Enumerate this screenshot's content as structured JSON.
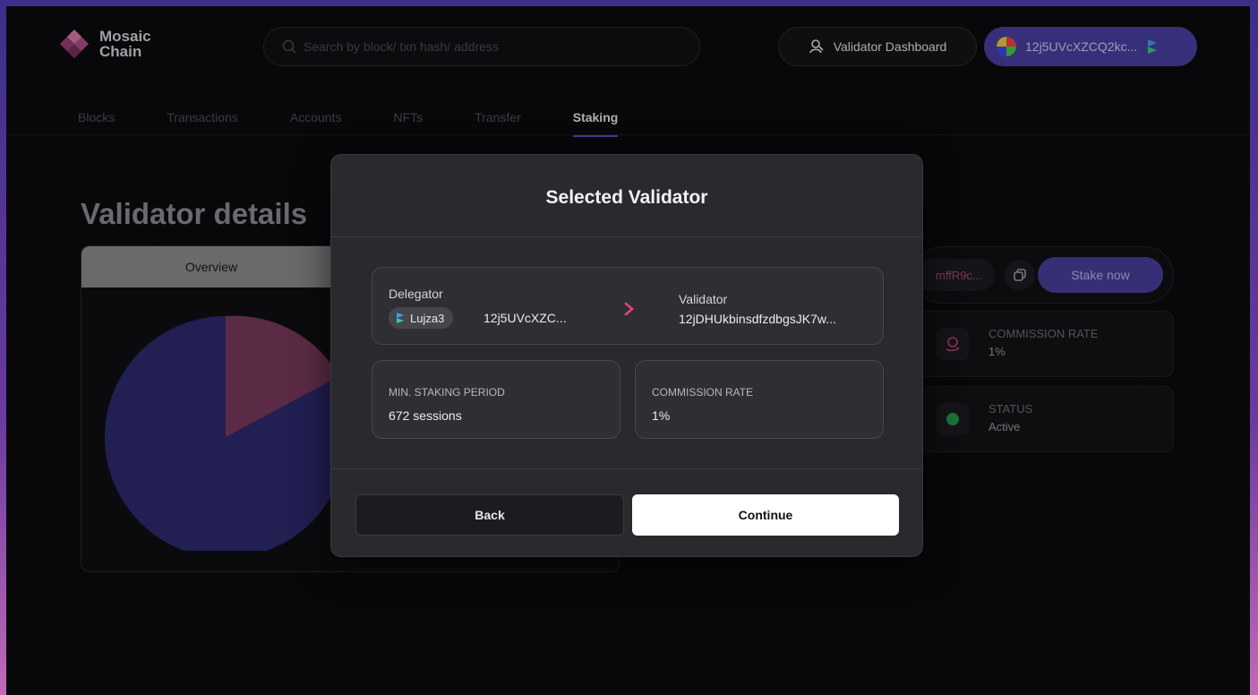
{
  "header": {
    "logo_line1": "Mosaic",
    "logo_line2": "Chain",
    "search_placeholder": "Search by block/ txn hash/ address",
    "dashboard_label": "Validator Dashboard",
    "wallet_address": "12j5UVcXZCQ2kc..."
  },
  "nav": {
    "items": [
      "Blocks",
      "Transactions",
      "Accounts",
      "NFTs",
      "Transfer",
      "Staking"
    ],
    "active": "Staking"
  },
  "page": {
    "title": "Validator details",
    "overview_tab": "Overview",
    "pie_chart_colors": [
      "#2e2a6e",
      "#7a3a5c"
    ],
    "validator_addr_short": "mffR9c...",
    "stake_now_label": "Stake now",
    "commission_label": "COMMISSION RATE",
    "commission_value": "1%",
    "status_label": "STATUS",
    "status_value": "Active",
    "status_color": "#239a4a"
  },
  "modal": {
    "title": "Selected Validator",
    "delegator_label": "Delegator",
    "delegator_name": "Lujza3",
    "delegator_addr": "12j5UVcXZC...",
    "validator_label": "Validator",
    "validator_addr": "12jDHUkbinsdfzdbgsJK7w...",
    "min_staking_label": "MIN. STAKING PERIOD",
    "min_staking_value": "672 sessions",
    "commission_label": "COMMISSION RATE",
    "commission_value": "1%",
    "back_label": "Back",
    "continue_label": "Continue",
    "accent_color": "#e0457b"
  }
}
